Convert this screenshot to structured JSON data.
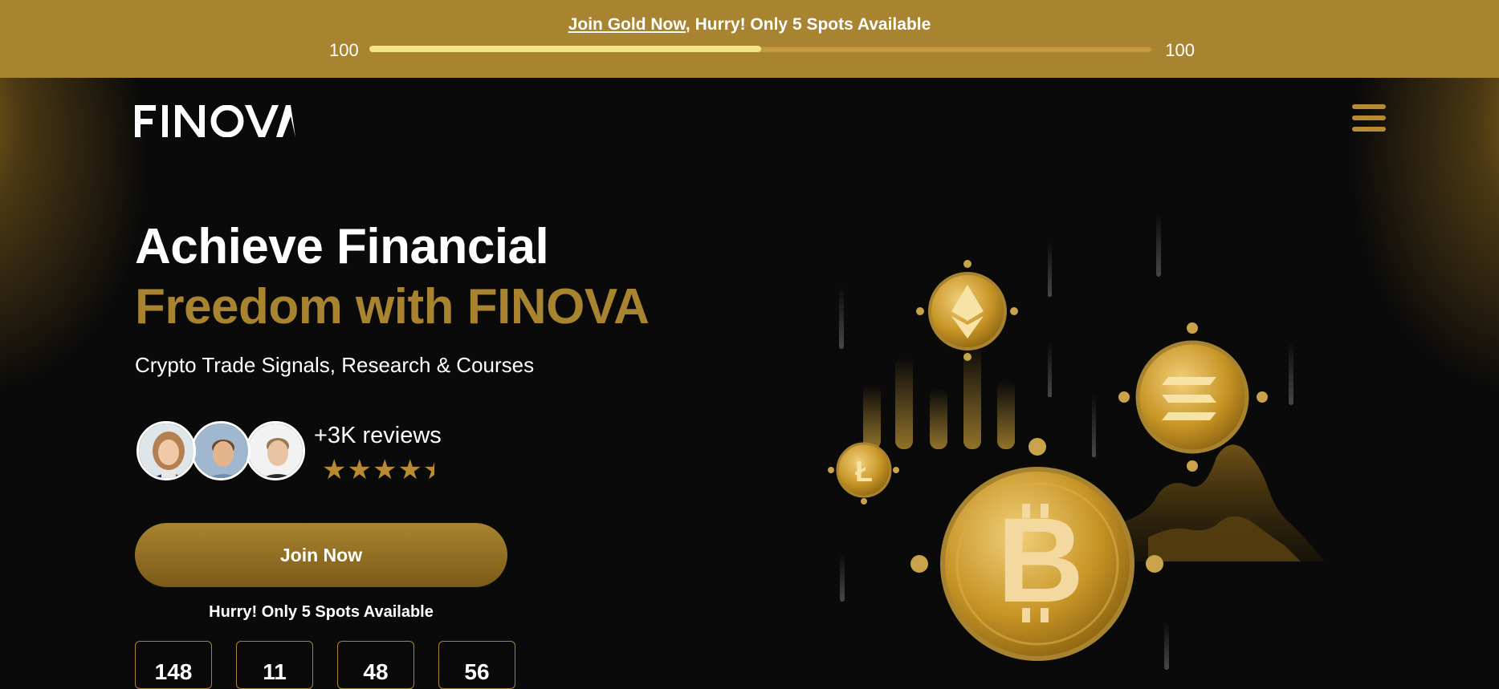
{
  "promo": {
    "join_link": "Join Gold Now",
    "text_after": ", Hurry! Only 5 Spots Available",
    "progress_left": "100",
    "progress_right": "100",
    "progress_fraction": 0.5
  },
  "header": {
    "logo_text": "FINOVA"
  },
  "hero": {
    "headline_line1": "Achieve Financial",
    "headline_line2": "Freedom with FINOVA",
    "subheadline": "Crypto Trade Signals, Research & Courses",
    "reviews_label": "+3K reviews",
    "rating": 4.5,
    "stars_display": "★★★★★",
    "cta_label": "Join Now",
    "hurry_text": "Hurry! Only 5 Spots Available",
    "countdown": [
      "148",
      "11",
      "48",
      "56"
    ]
  },
  "colors": {
    "gold": "#a98430",
    "gold_dark": "#7a5a18",
    "background": "#0a0a0a",
    "white": "#ffffff"
  },
  "icons": {
    "menu": "hamburger-menu-icon",
    "coins": [
      "ethereum-coin-icon",
      "solana-coin-icon",
      "litecoin-coin-icon",
      "bitcoin-coin-icon"
    ]
  }
}
